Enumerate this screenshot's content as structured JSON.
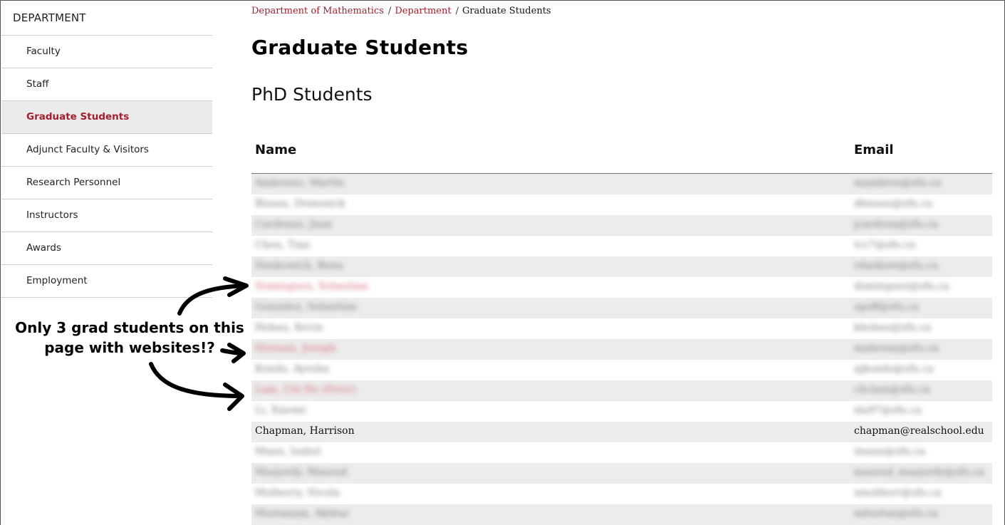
{
  "sidebar": {
    "title": "DEPARTMENT",
    "items": [
      {
        "label": "Faculty"
      },
      {
        "label": "Staff"
      },
      {
        "label": "Graduate Students"
      },
      {
        "label": "Adjunct Faculty & Visitors"
      },
      {
        "label": "Research Personnel"
      },
      {
        "label": "Instructors"
      },
      {
        "label": "Awards"
      },
      {
        "label": "Employment"
      }
    ],
    "active_index": 2
  },
  "breadcrumb": {
    "items": [
      "Department of Mathematics",
      "Department",
      "Graduate Students"
    ],
    "separator": "/"
  },
  "page": {
    "title": "Graduate Students",
    "section_title": "PhD Students"
  },
  "table": {
    "headers": {
      "name": "Name",
      "email": "Email"
    },
    "rows": [
      {
        "name": "Ambrosio, Martin",
        "email": "mambros@sfu.ca",
        "blurred": true,
        "link": false
      },
      {
        "name": "Bissau, Domenick",
        "email": "dbissau@sfu.ca",
        "blurred": true,
        "link": false
      },
      {
        "name": "Cardenas, Juan",
        "email": "jcardena@sfu.ca",
        "blurred": true,
        "link": false
      },
      {
        "name": "Chen, Tian",
        "email": "tcc7@sfu.ca",
        "blurred": true,
        "link": false
      },
      {
        "name": "Dankowich, Rena",
        "email": "rdankow@sfu.ca",
        "blurred": true,
        "link": false
      },
      {
        "name": "Dominguez, Sebastian",
        "email": "dominguez@sfu.ca",
        "blurred": true,
        "link": true
      },
      {
        "name": "Gonzalez, Sebastian",
        "email": "sgoff@sfu.ca",
        "blurred": true,
        "link": false
      },
      {
        "name": "Hebau, Kevin",
        "email": "khebau@sfu.ca",
        "blurred": true,
        "link": false
      },
      {
        "name": "Hrenaia, Joseph",
        "email": "mahrena@sfu.ca",
        "blurred": true,
        "link": true
      },
      {
        "name": "Kondo, Ayesha",
        "email": "ajkondo@sfu.ca",
        "blurred": true,
        "link": false
      },
      {
        "name": "Lam, Chi Ho (Peter)",
        "email": "chclam@sfu.ca",
        "blurred": true,
        "link": true
      },
      {
        "name": "Li, Xiaomi",
        "email": "xla97@sfu.ca",
        "blurred": true,
        "link": false
      },
      {
        "name": "Chapman, Harrison",
        "email": "chapman@realschool.edu",
        "blurred": false,
        "link": false
      },
      {
        "name": "Mann, Isabel",
        "email": "imann@sfu.ca",
        "blurred": true,
        "link": false
      },
      {
        "name": "Masjordy, Masoud",
        "email": "masoud_masjordy@sfu.ca",
        "blurred": true,
        "link": false
      },
      {
        "name": "Mulberry, Nicola",
        "email": "nmulberr@sfu.ca",
        "blurred": true,
        "link": false
      },
      {
        "name": "Mustanam, Akhtar",
        "email": "mhustan@sfu.ca",
        "blurred": true,
        "link": false
      }
    ]
  },
  "annotation": {
    "text": "Only 3 grad students on this page with websites!?"
  }
}
